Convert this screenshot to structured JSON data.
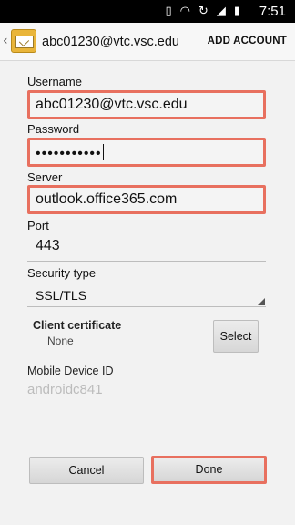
{
  "status_bar": {
    "time": "7:51",
    "icons": [
      "vibrate-icon",
      "wifi-icon",
      "sync-icon",
      "signal-icon",
      "battery-icon"
    ]
  },
  "action_bar": {
    "title": "abc01230@vtc.vsc.edu",
    "add_account_label": "ADD ACCOUNT",
    "app_icon": "email-app-icon"
  },
  "form": {
    "username": {
      "label": "Username",
      "value": "abc01230@vtc.vsc.edu"
    },
    "password": {
      "label": "Password",
      "value": "•••••••••••"
    },
    "server": {
      "label": "Server",
      "value": "outlook.office365.com"
    },
    "port": {
      "label": "Port",
      "value": "443"
    },
    "security_type": {
      "label": "Security type",
      "value": "SSL/TLS"
    },
    "client_certificate": {
      "label": "Client certificate",
      "value": "None",
      "button_label": "Select"
    },
    "mobile_device_id": {
      "label": "Mobile Device ID",
      "value": "androidc841"
    }
  },
  "buttons": {
    "cancel": "Cancel",
    "done": "Done"
  },
  "colors": {
    "highlight": "#e8705f",
    "status_bar": "#000000",
    "background": "#f2f2f2"
  }
}
